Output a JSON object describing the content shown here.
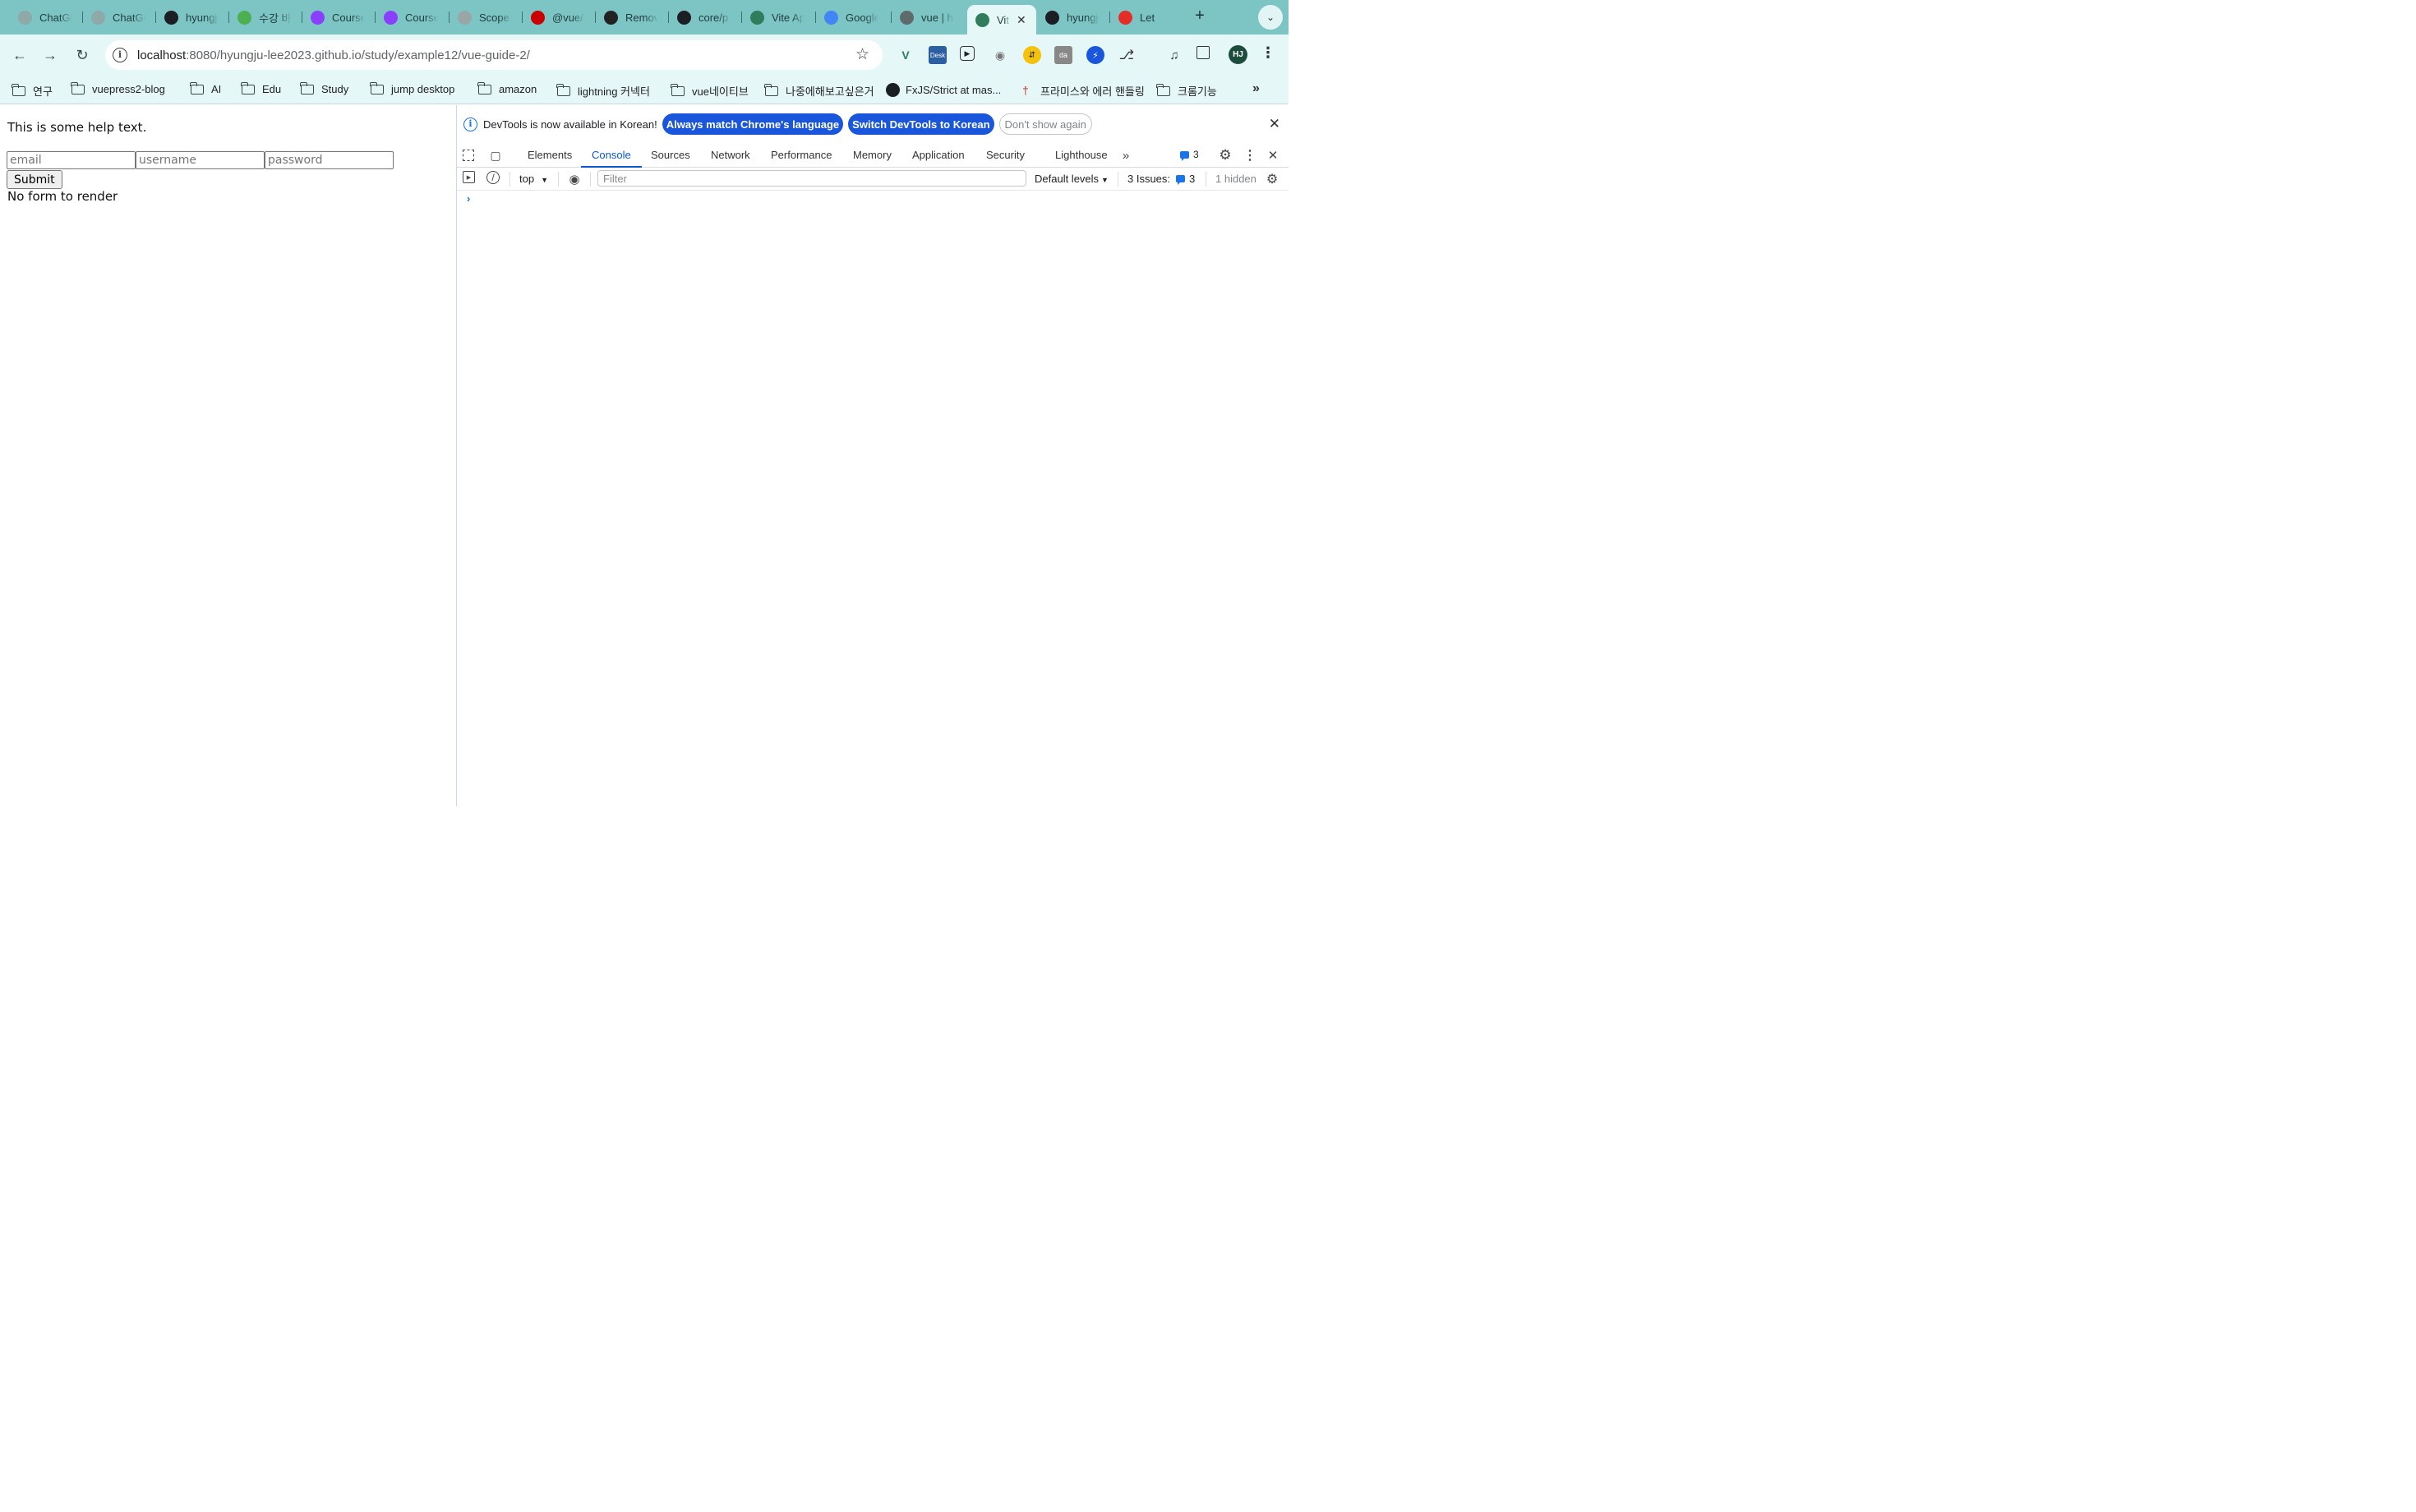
{
  "browser": {
    "tabs": [
      {
        "title": "ChatGPT",
        "icon": "openai-icon",
        "color": "#8fa8a8"
      },
      {
        "title": "ChatGPT",
        "icon": "openai-icon",
        "color": "#8fa8a8"
      },
      {
        "title": "hyungju",
        "icon": "github-icon",
        "color": "#1b1f23"
      },
      {
        "title": "수강 바구니",
        "icon": "inflearn-icon",
        "color": "#4caf50"
      },
      {
        "title": "Course",
        "icon": "udemy-icon",
        "color": "#8a3ffc"
      },
      {
        "title": "Course",
        "icon": "udemy-icon",
        "color": "#8a3ffc"
      },
      {
        "title": "Scope",
        "icon": "globe-icon",
        "color": "#9aa6a6"
      },
      {
        "title": "@vue/",
        "icon": "npm-icon",
        "color": "#cb0000"
      },
      {
        "title": "Remove",
        "icon": "r-icon",
        "color": "#222222"
      },
      {
        "title": "core/p",
        "icon": "github-icon",
        "color": "#1b1f23"
      },
      {
        "title": "Vite App",
        "icon": "vue-icon",
        "color": "#2f7d5a"
      },
      {
        "title": "Google",
        "icon": "translate-icon",
        "color": "#4285f4"
      },
      {
        "title": "vue | h",
        "icon": "globe-icon",
        "color": "#5f6b6b"
      },
      {
        "title": "Vite App",
        "icon": "vue-icon",
        "color": "#2f7d5a"
      },
      {
        "title": "hyungju",
        "icon": "github-icon",
        "color": "#1b1f23"
      },
      {
        "title": "Let",
        "icon": "youtube-icon",
        "color": "#e52d27"
      }
    ],
    "active_tab_index": 13,
    "url_host": "localhost",
    "url_path": ":8080/hyungju-lee2023.github.io/study/example12/vue-guide-2/",
    "avatar": "HJ",
    "bookmarks": [
      {
        "label": "연구",
        "type": "folder"
      },
      {
        "label": "vuepress2-blog",
        "type": "folder"
      },
      {
        "label": "AI",
        "type": "folder"
      },
      {
        "label": "Edu",
        "type": "folder"
      },
      {
        "label": "Study",
        "type": "folder"
      },
      {
        "label": "jump desktop",
        "type": "folder"
      },
      {
        "label": "amazon",
        "type": "folder"
      },
      {
        "label": "lightning 커넥터",
        "type": "folder"
      },
      {
        "label": "vue네이티브",
        "type": "folder"
      },
      {
        "label": "나중에해보고싶은거",
        "type": "folder"
      },
      {
        "label": "FxJS/Strict at mas...",
        "type": "github"
      },
      {
        "label": "프라미스와 에러 핸들링",
        "type": "pin"
      },
      {
        "label": "크롬기능",
        "type": "folder"
      }
    ]
  },
  "page": {
    "help_text": "This is some help text.",
    "email_placeholder": "email",
    "username_placeholder": "username",
    "password_placeholder": "password",
    "submit_label": "Submit",
    "no_form_text": "No form to render"
  },
  "devtools": {
    "infobar_message": "DevTools is now available in Korean!",
    "btn_match": "Always match Chrome's language",
    "btn_switch": "Switch DevTools to Korean",
    "btn_dismiss": "Don't show again",
    "tabs": [
      "Elements",
      "Console",
      "Sources",
      "Network",
      "Performance",
      "Memory",
      "Application",
      "Security",
      "Lighthouse"
    ],
    "active_tab": "Console",
    "issues_badge": "3",
    "context": "top",
    "filter_placeholder": "Filter",
    "levels": "Default levels",
    "issues_label": "3 Issues:",
    "issues_count": "3",
    "hidden_label": "1 hidden",
    "prompt": "›"
  },
  "colors": {
    "tabstrip": "#7dc4c4",
    "toolbar": "#e6f7f7",
    "accent": "#1a56db"
  }
}
